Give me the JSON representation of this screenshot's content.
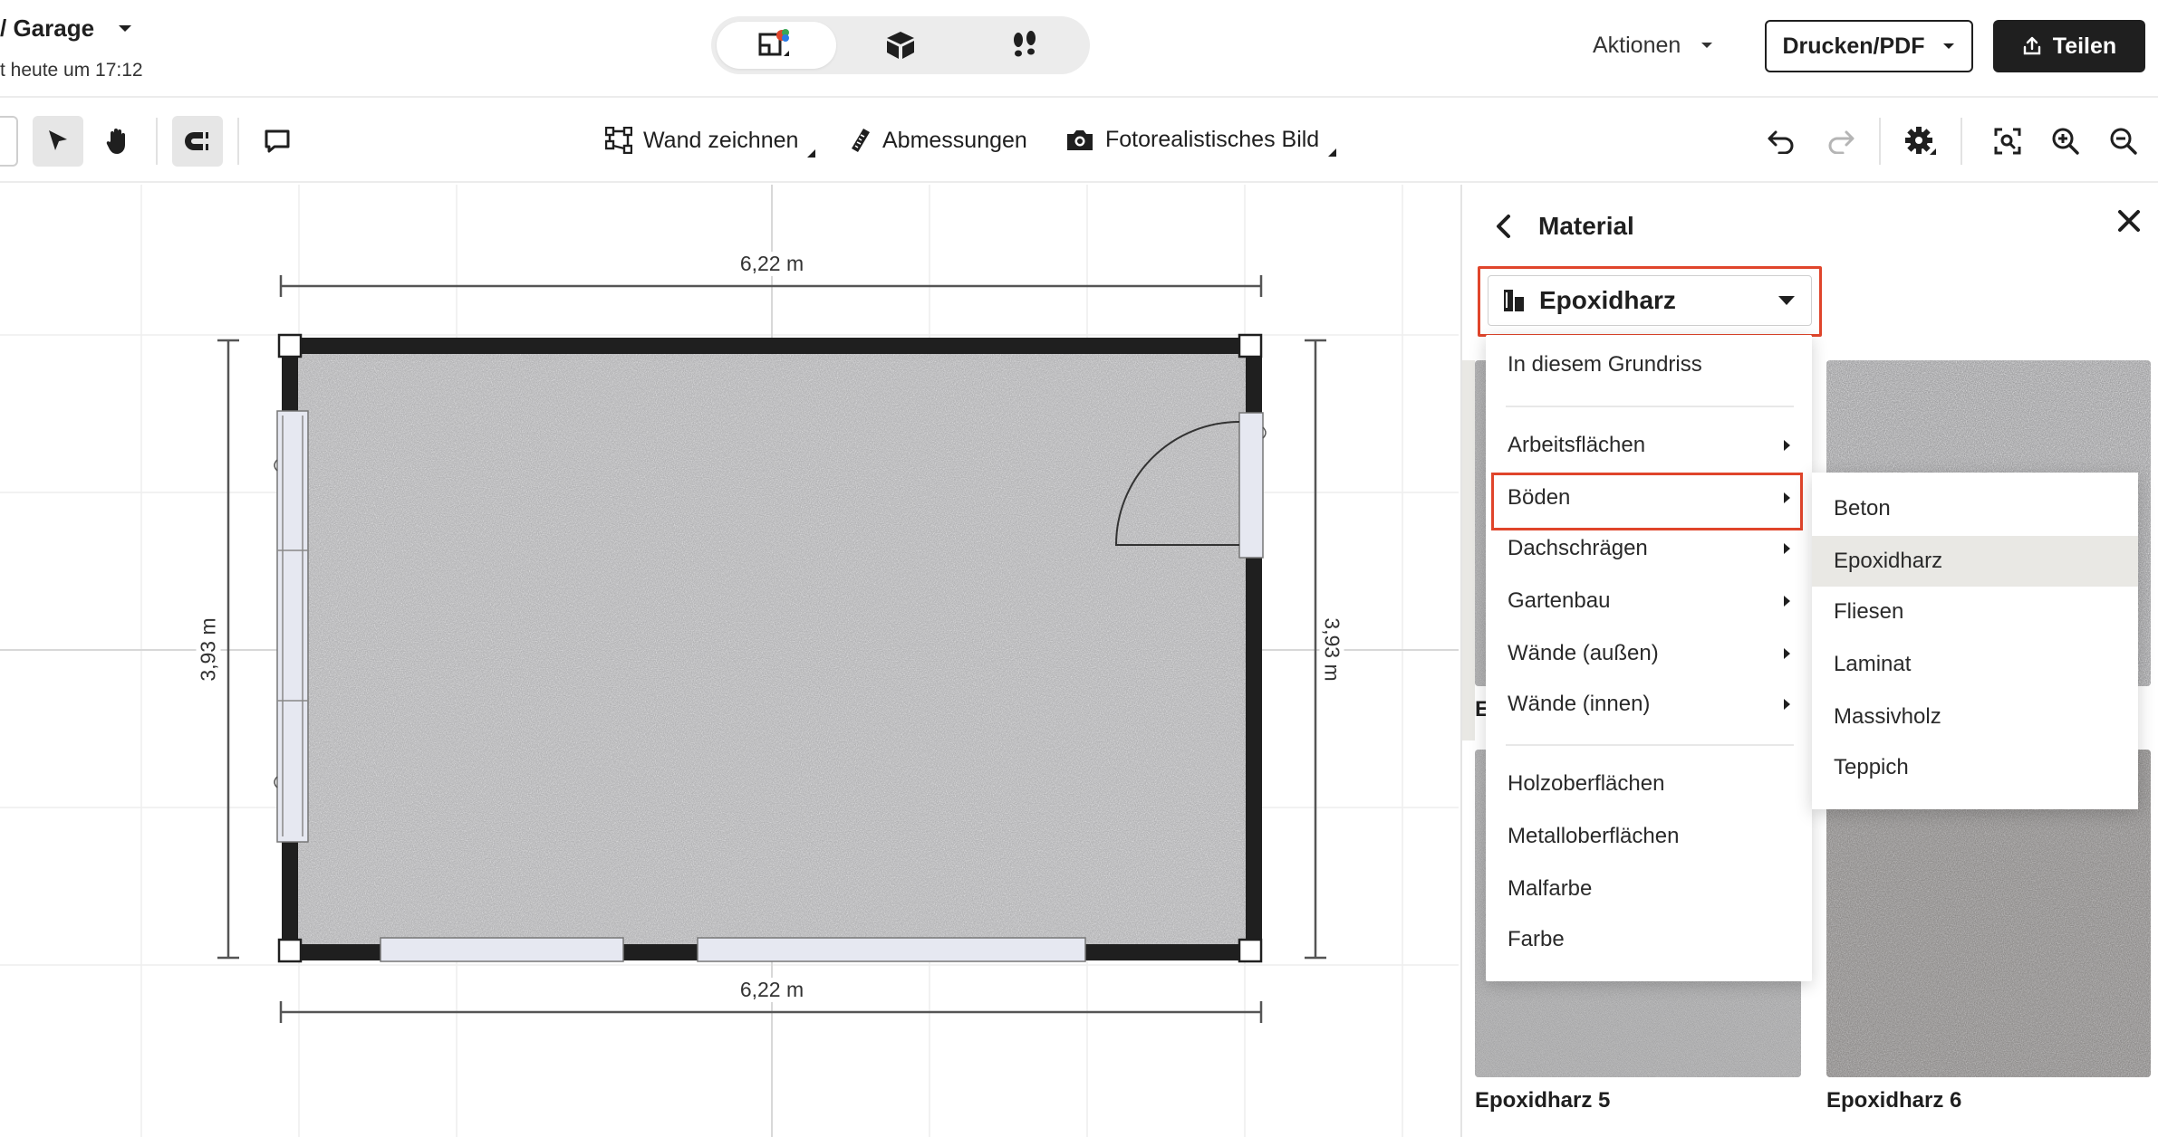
{
  "header": {
    "project_title": "/ Garage",
    "saved_text": "t heute um 17:12",
    "view_modes": [
      {
        "name": "2d-plan-icon",
        "active": true
      },
      {
        "name": "3d-box-icon",
        "active": false
      },
      {
        "name": "walk-footprints-icon",
        "active": false
      }
    ],
    "actions_label": "Aktionen",
    "print_label": "Drucken/PDF",
    "share_label": "Teilen"
  },
  "toolbar": {
    "draw_wall_label": "Wand zeichnen",
    "dimensions_label": "Abmessungen",
    "photo_label": "Fotorealistisches Bild"
  },
  "canvas": {
    "dim_top": "6,22 m",
    "dim_bottom": "6,22 m",
    "dim_left": "3,93 m",
    "dim_right": "3,93 m",
    "floor_color": "#a9a9ab",
    "wall_color": "#1f1f1f"
  },
  "panel": {
    "title": "Material",
    "selected_material": "Epoxidharz",
    "tiles": [
      {
        "label": "E"
      },
      {
        "label": ""
      },
      {
        "label": "Epoxidharz 5"
      },
      {
        "label": "Epoxidharz 6"
      }
    ]
  },
  "menu": {
    "in_plan": "In diesem Grundriss",
    "categories": [
      {
        "label": "Arbeitsflächen",
        "has_sub": true
      },
      {
        "label": "Böden",
        "has_sub": true,
        "highlighted": true
      },
      {
        "label": "Dachschrägen",
        "has_sub": true
      },
      {
        "label": "Gartenbau",
        "has_sub": true
      },
      {
        "label": "Wände (außen)",
        "has_sub": true
      },
      {
        "label": "Wände (innen)",
        "has_sub": true
      }
    ],
    "others": [
      {
        "label": "Holzoberflächen"
      },
      {
        "label": "Metalloberflächen"
      },
      {
        "label": "Malfarbe"
      },
      {
        "label": "Farbe"
      }
    ],
    "submenu": [
      {
        "label": "Beton",
        "selected": false
      },
      {
        "label": "Epoxidharz",
        "selected": true
      },
      {
        "label": "Fliesen",
        "selected": false
      },
      {
        "label": "Laminat",
        "selected": false
      },
      {
        "label": "Massivholz",
        "selected": false
      },
      {
        "label": "Teppich",
        "selected": false
      }
    ]
  },
  "colors": {
    "accent_red": "#e0452b",
    "dark": "#1f1f1f"
  }
}
